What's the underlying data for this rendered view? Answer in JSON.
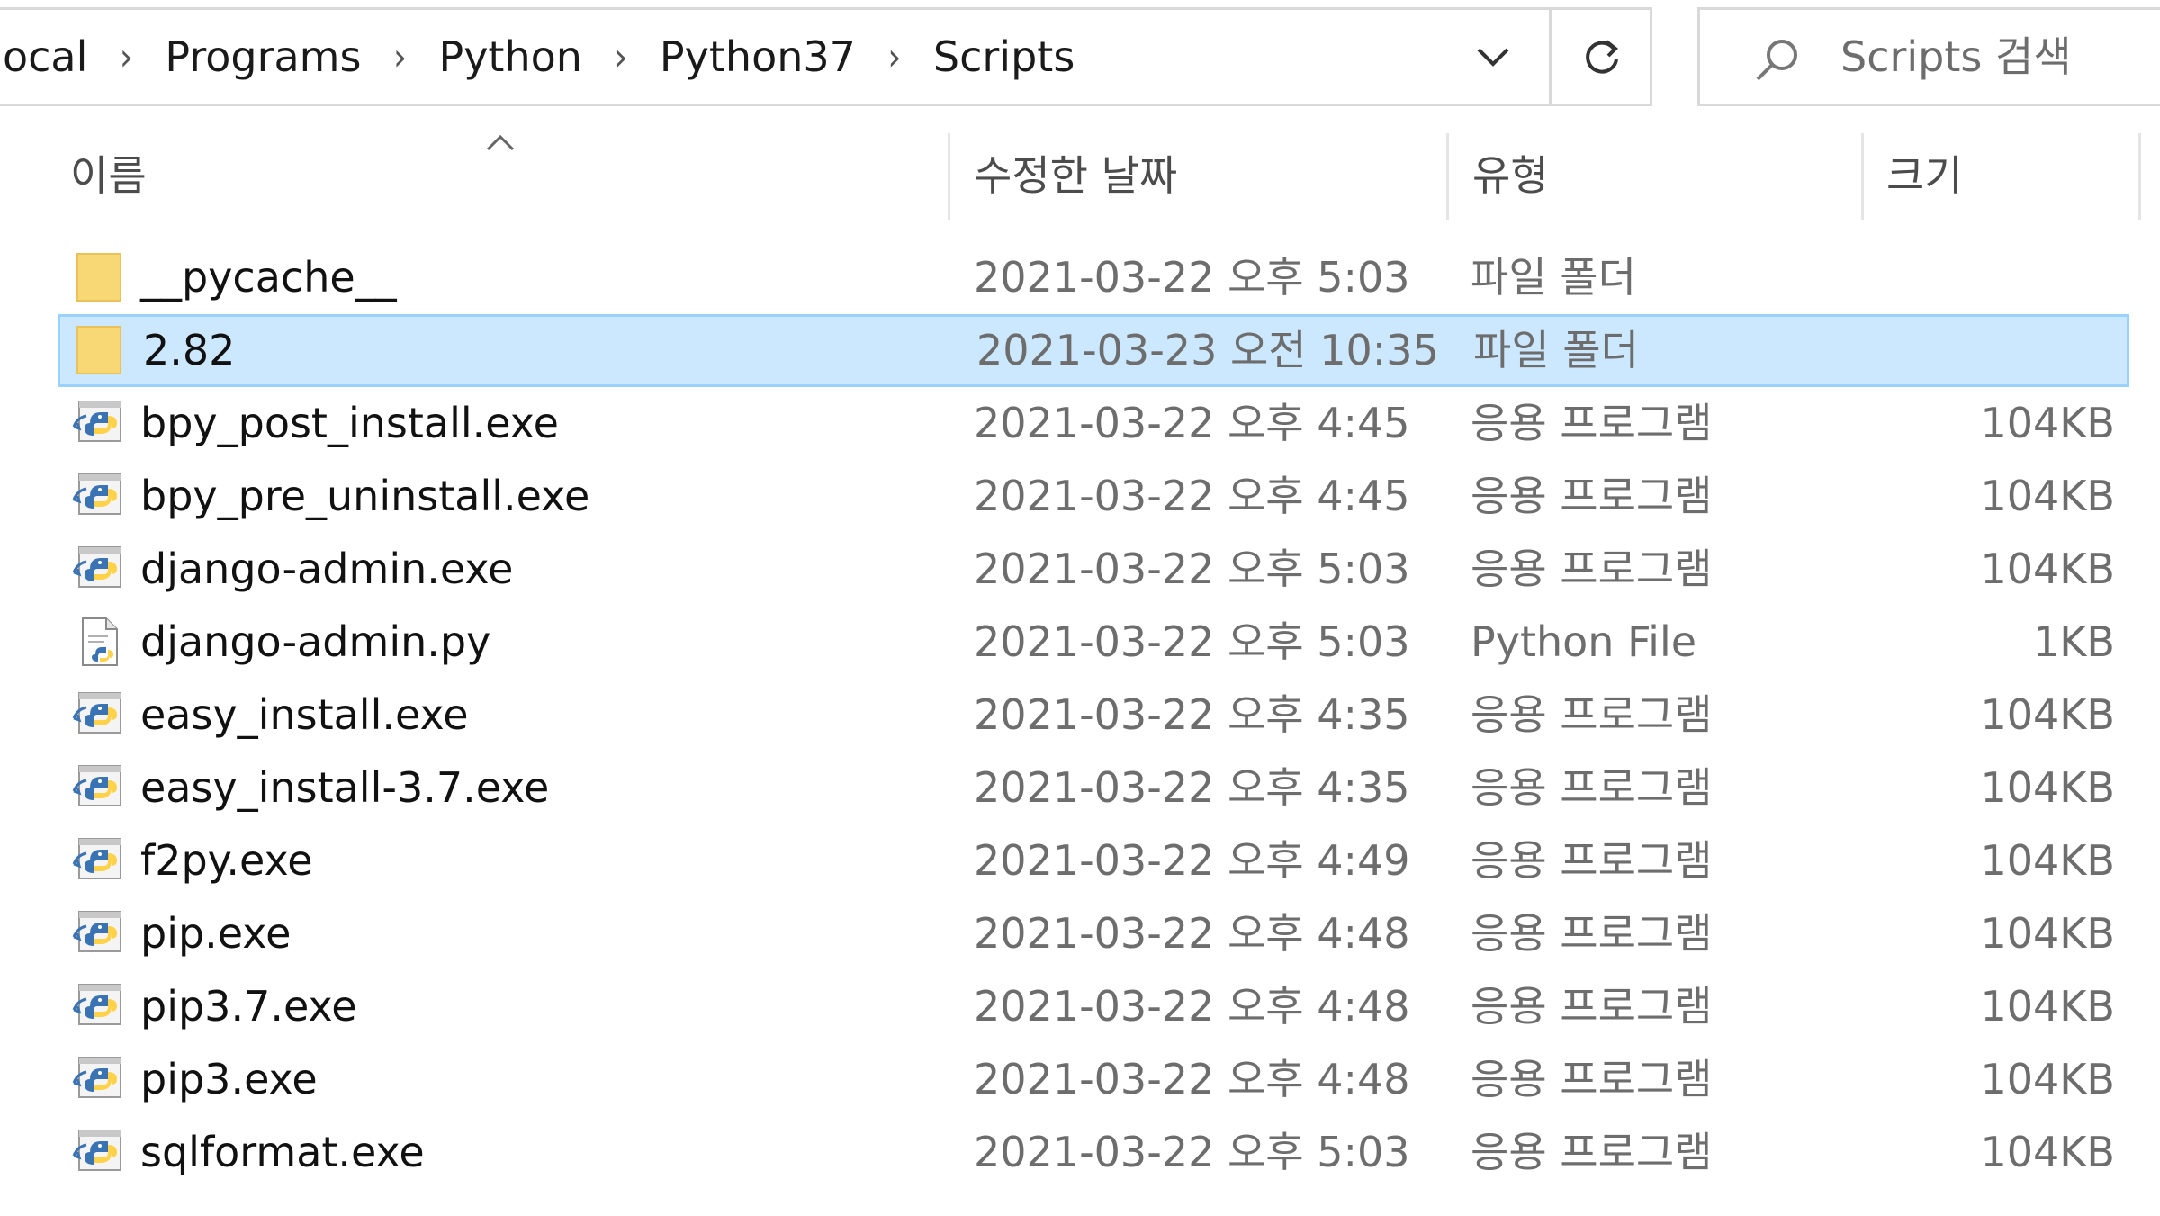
{
  "address_bar": {
    "breadcrumbs": [
      "ocal",
      "Programs",
      "Python",
      "Python37",
      "Scripts"
    ],
    "separator_icon": "chevron-right-icon",
    "dropdown_icon": "chevron-down-icon",
    "refresh_icon": "refresh-icon"
  },
  "search": {
    "icon": "search-icon",
    "placeholder": "Scripts 검색"
  },
  "columns": {
    "name": "이름",
    "date": "수정한 날짜",
    "type": "유형",
    "size": "크기",
    "sort_indicator": "sort-ascending-icon"
  },
  "colors": {
    "selection_bg": "#cce8ff",
    "selection_border": "#99d1ff",
    "folder_yellow": "#f8d775",
    "secondary_text": "#6d6d6d"
  },
  "files": [
    {
      "icon": "folder-icon",
      "name": "__pycache__",
      "date": "2021-03-22 오후 5:03",
      "type": "파일 폴더",
      "size": "",
      "selected": false
    },
    {
      "icon": "folder-icon",
      "name": "2.82",
      "date": "2021-03-23 오전 10:35",
      "type": "파일 폴더",
      "size": "",
      "selected": true
    },
    {
      "icon": "python-exe-icon",
      "name": "bpy_post_install.exe",
      "date": "2021-03-22 오후 4:45",
      "type": "응용 프로그램",
      "size": "104KB",
      "selected": false
    },
    {
      "icon": "python-exe-icon",
      "name": "bpy_pre_uninstall.exe",
      "date": "2021-03-22 오후 4:45",
      "type": "응용 프로그램",
      "size": "104KB",
      "selected": false
    },
    {
      "icon": "python-exe-icon",
      "name": "django-admin.exe",
      "date": "2021-03-22 오후 5:03",
      "type": "응용 프로그램",
      "size": "104KB",
      "selected": false
    },
    {
      "icon": "python-file-icon",
      "name": "django-admin.py",
      "date": "2021-03-22 오후 5:03",
      "type": "Python File",
      "size": "1KB",
      "selected": false
    },
    {
      "icon": "python-exe-icon",
      "name": "easy_install.exe",
      "date": "2021-03-22 오후 4:35",
      "type": "응용 프로그램",
      "size": "104KB",
      "selected": false
    },
    {
      "icon": "python-exe-icon",
      "name": "easy_install-3.7.exe",
      "date": "2021-03-22 오후 4:35",
      "type": "응용 프로그램",
      "size": "104KB",
      "selected": false
    },
    {
      "icon": "python-exe-icon",
      "name": "f2py.exe",
      "date": "2021-03-22 오후 4:49",
      "type": "응용 프로그램",
      "size": "104KB",
      "selected": false
    },
    {
      "icon": "python-exe-icon",
      "name": "pip.exe",
      "date": "2021-03-22 오후 4:48",
      "type": "응용 프로그램",
      "size": "104KB",
      "selected": false
    },
    {
      "icon": "python-exe-icon",
      "name": "pip3.7.exe",
      "date": "2021-03-22 오후 4:48",
      "type": "응용 프로그램",
      "size": "104KB",
      "selected": false
    },
    {
      "icon": "python-exe-icon",
      "name": "pip3.exe",
      "date": "2021-03-22 오후 4:48",
      "type": "응용 프로그램",
      "size": "104KB",
      "selected": false
    },
    {
      "icon": "python-exe-icon",
      "name": "sqlformat.exe",
      "date": "2021-03-22 오후 5:03",
      "type": "응용 프로그램",
      "size": "104KB",
      "selected": false
    }
  ]
}
